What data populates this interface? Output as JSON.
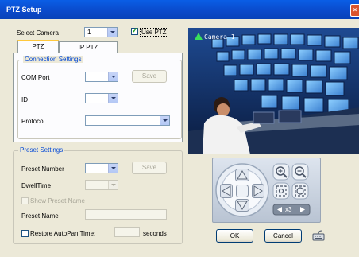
{
  "window": {
    "title": "PTZ Setup",
    "close_glyph": "×"
  },
  "camera_select": {
    "label": "Select Camera",
    "value": "1"
  },
  "use_ptz": {
    "label": "Use PTZ",
    "checked": true
  },
  "tabs": [
    {
      "label": "PTZ",
      "active": true
    },
    {
      "label": "IP PTZ",
      "active": false
    }
  ],
  "connection": {
    "title": "Connection Settings",
    "com_port_label": "COM Port",
    "save_label": "Save",
    "id_label": "ID",
    "protocol_label": "Protocol"
  },
  "preset": {
    "title": "Preset Settings",
    "number_label": "Preset Number",
    "save_label": "Save",
    "dwell_label": "DwellTime",
    "show_name_label": "Show Preset Name",
    "name_label": "Preset Name",
    "restore_label": "Restore AutoPan Time:",
    "seconds_label": "seconds"
  },
  "video": {
    "camera_label": "Camera 1"
  },
  "ptz_controls": {
    "speed_label": "x3",
    "icons": [
      "arrow-up-icon",
      "arrow-left-icon",
      "arrow-right-icon",
      "arrow-down-icon",
      "zoom-in-icon",
      "zoom-out-icon",
      "focus-near-icon",
      "focus-far-icon"
    ]
  },
  "buttons": {
    "ok": "OK",
    "cancel": "Cancel"
  }
}
